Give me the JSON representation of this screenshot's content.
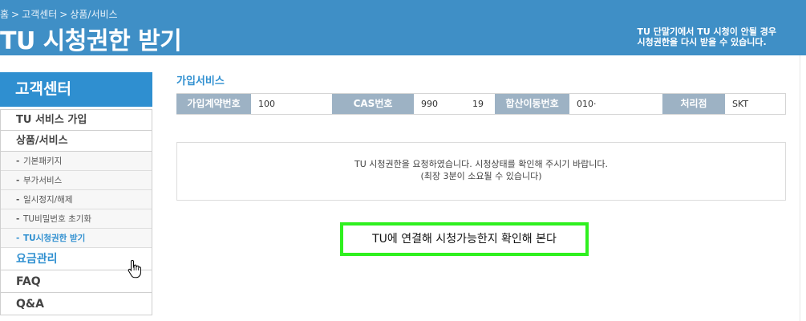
{
  "header": {
    "breadcrumb": [
      "홈",
      "고객센터",
      "상품/서비스"
    ],
    "breadcrumb_separator": ">",
    "title": "TU 시청권한 받기",
    "note_line1": "TU 단말기에서 TU 시청이 안될 경우",
    "note_line2": "시청권한을 다시 받을 수 있습니다."
  },
  "sidebar": {
    "heading": "고객센터",
    "items": [
      {
        "label": "TU 서비스 가입"
      },
      {
        "label": "상품/서비스"
      }
    ],
    "sub_items": [
      {
        "label": "기본패키지"
      },
      {
        "label": "부가서비스"
      },
      {
        "label": "일시정지/해제"
      },
      {
        "label": "TU비밀번호 초기화"
      },
      {
        "label": "TU시청권한 받기"
      }
    ],
    "bottom_items": [
      {
        "label": "요금관리"
      },
      {
        "label": "FAQ"
      },
      {
        "label": "Q&A"
      }
    ],
    "sub_dash": "-"
  },
  "main": {
    "section_title": "가입서비스",
    "table": {
      "subscription_no_label": "가입계약번호",
      "subscription_no_value": "100",
      "cas_label": "CAS번호",
      "cas_value_1": "990",
      "cas_value_2": "19",
      "mobile_label": "합산이동번호",
      "mobile_value": "010·",
      "agency_label": "처리점",
      "agency_value": "SKT"
    },
    "notice_line1": "TU 시청권한을 요청하였습니다. 시청상태를 확인해 주시기 바랍니다.",
    "notice_line2": "(최장 3분이 소요될 수 있습니다)",
    "check_button": "TU에 연결해 시청가능한지 확인해 본다"
  },
  "colors": {
    "header_bg": "#3f8fc6",
    "accent": "#2f8fd0",
    "label_bg": "#9db2c4",
    "highlight": "#2ff01f"
  },
  "icons": {
    "cursor": "hand-pointer-icon"
  }
}
